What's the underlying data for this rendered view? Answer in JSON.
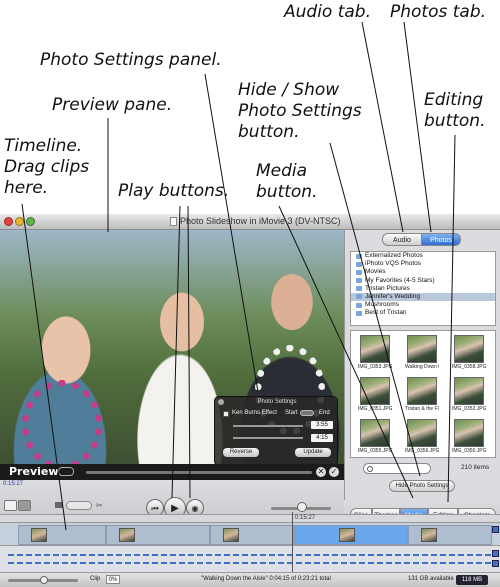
{
  "callouts": {
    "audio_tab": "Audio tab.",
    "photos_tab": "Photos tab.",
    "photo_settings_panel": "Photo Settings panel.",
    "preview_pane": "Preview pane.",
    "hide_show": "Hide / Show\nPhoto Settings\nbutton.",
    "editing_button": "Editing\nbutton.",
    "timeline": "Timeline.\nDrag clips\nhere.",
    "play_buttons": "Play buttons.",
    "media_button": "Media\nbutton."
  },
  "window": {
    "title": "Photo Slideshow in iMovie 3 (DV-NTSC)"
  },
  "preview": {
    "label": "Preview",
    "close_glyph": "✕",
    "ok_glyph": "✓"
  },
  "photo_settings": {
    "title": "Photo Settings",
    "ken_burns": "Ken Burns Effect",
    "start": "Start",
    "end": "End",
    "duration": "3:55",
    "zoom": "4:15",
    "reverse": "Reverse",
    "update": "Update"
  },
  "media": {
    "tabs": {
      "audio": "Audio",
      "photos": "Photos"
    },
    "albums": [
      "Externalized Photos",
      "iPhoto VQS Photos",
      "Movies",
      "My Favorites (4-5 Stars)",
      "Tristan Pictures",
      "Jennifer's Wedding",
      "Mushrooms",
      "Best of Tristan"
    ],
    "selected_album_index": 5,
    "photos": [
      "IMG_0353.JPG",
      "Walking Down t...",
      "IMG_0358.JPG",
      "IMG_0351.JPG",
      "Tristan & the Fl...",
      "IMG_0352.JPG",
      "IMG_0355.JPG",
      "IMG_0356.JPG",
      "IMG_0350.JPG"
    ],
    "item_count": "210 items",
    "hide_button": "Hide Photo Settings"
  },
  "controls": {
    "timecode": "0:15:27",
    "rewind_glyph": "⏮",
    "play_glyph": "▶",
    "fullscreen_glyph": "◉"
  },
  "edit_tabs": [
    "Clips",
    "Themes",
    "Media",
    "Editing",
    "Chapters"
  ],
  "active_edit_tab": "Media",
  "timeline": {
    "ruler_time": "0:15:27",
    "clips": 5
  },
  "status": {
    "clip_label": "Clip",
    "clip_value": "0%",
    "text": "\"Walking Down the Aisle\" 0:04:15 of 0:23:21 total",
    "available": "131 GB available",
    "memory": "118 MB"
  }
}
